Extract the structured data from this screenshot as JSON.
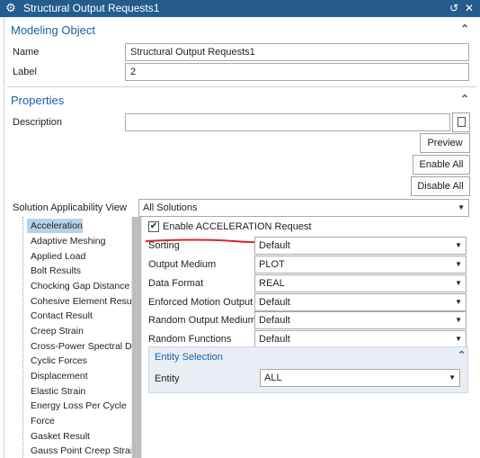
{
  "window": {
    "title": "Structural Output Requests1"
  },
  "modeling_object": {
    "title": "Modeling Object",
    "name_label": "Name",
    "name_value": "Structural Output Requests1",
    "label_label": "Label",
    "label_value": "2"
  },
  "properties": {
    "title": "Properties",
    "description_label": "Description",
    "description_value": "",
    "preview_label": "Preview",
    "enable_all_label": "Enable All",
    "disable_all_label": "Disable All",
    "solution_view_label": "Solution Applicability View",
    "solution_view_value": "All Solutions"
  },
  "tree": {
    "items": [
      "Acceleration",
      "Adaptive Meshing",
      "Applied Load",
      "Bolt Results",
      "Chocking Gap Distance",
      "Cohesive Element Results",
      "Contact Result",
      "Creep Strain",
      "Cross-Power Spectral Den",
      "Cyclic Forces",
      "Displacement",
      "Elastic Strain",
      "Energy Loss Per Cycle",
      "Force",
      "Gasket Result",
      "Gauss Point Creep Strain"
    ],
    "selected_index": 0
  },
  "request": {
    "enable_label": "Enable ACCELERATION Request",
    "enable_checked": true,
    "rows": [
      {
        "label": "Sorting",
        "value": "Default"
      },
      {
        "label": "Output Medium",
        "value": "PLOT"
      },
      {
        "label": "Data Format",
        "value": "REAL"
      },
      {
        "label": "Enforced Motion Output",
        "value": "Default"
      },
      {
        "label": "Random Output Medium",
        "value": "Default"
      },
      {
        "label": "Random Functions",
        "value": "Default"
      }
    ]
  },
  "entity_selection": {
    "title": "Entity Selection",
    "entity_label": "Entity",
    "entity_value": "ALL"
  },
  "icons": {
    "title_icon": "gear-icon",
    "reset": "reset-icon",
    "close": "close-icon",
    "collapse": "chevron-up-icon",
    "dropdown": "chevron-down-icon",
    "browse": "page-icon"
  },
  "colors": {
    "titlebar": "#245c8e",
    "section_title": "#1e5fa0",
    "selection": "#b8d1ea",
    "annotation": "#d9262c"
  }
}
